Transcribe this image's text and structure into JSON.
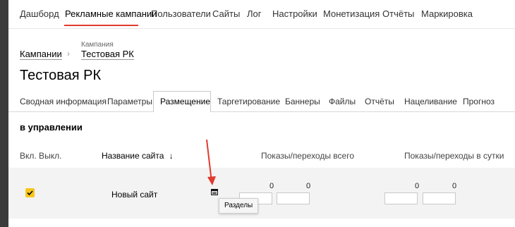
{
  "topnav": {
    "items": [
      "Дашборд",
      "Рекламные кампании",
      "Пользователи",
      "Сайты",
      "Лог",
      "Настройки",
      "Монетизация",
      "Отчёты",
      "Маркировка"
    ],
    "active_index": 1
  },
  "breadcrumb": {
    "root": "Кампании",
    "current_label": "Кампания",
    "current": "Тестовая РК"
  },
  "page_title": "Тестовая РК",
  "tabs": {
    "items": [
      "Сводная информация",
      "Параметры",
      "Размещение",
      "Таргетирование",
      "Баннеры",
      "Файлы",
      "Отчёты",
      "Нацеливание",
      "Прогноз"
    ],
    "active_index": 2
  },
  "section_title": "в управлении",
  "table": {
    "headers": {
      "toggle": "Вкл. Выкл.",
      "site_name": "Название сайта",
      "sort_indicator": "↓",
      "total": "Показы/переходы всего",
      "daily": "Показы/переходы в сутки"
    },
    "rows": [
      {
        "enabled": true,
        "site": "Новый сайт",
        "total_shows": "0",
        "total_clicks": "0",
        "daily_shows": "0",
        "daily_clicks": "0"
      }
    ]
  },
  "tooltip": "Разделы",
  "colors": {
    "accent": "#e23a2f",
    "checkbox": "#f7c51d",
    "annotation_arrow": "#e23a2f"
  },
  "icons": [
    "sections-icon",
    "checkmark-icon",
    "chevron-right-icon"
  ]
}
